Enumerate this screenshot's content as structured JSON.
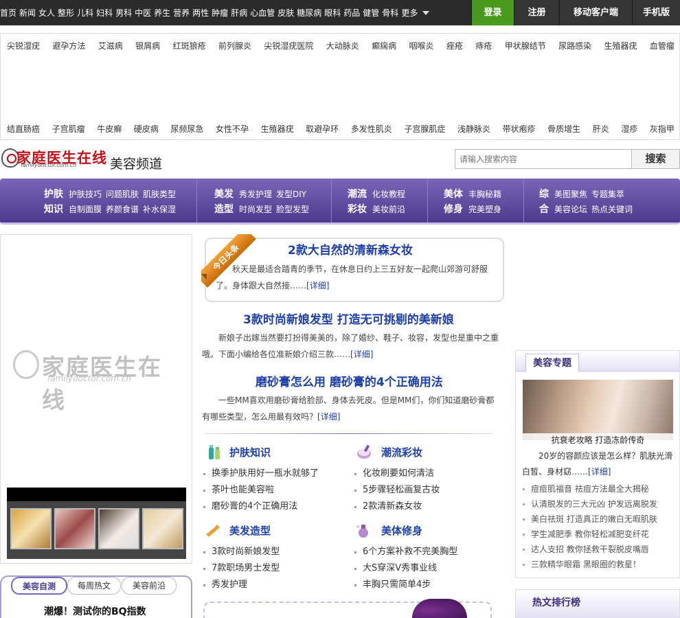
{
  "topnav": {
    "items": [
      "首页",
      "新闻",
      "女人",
      "整形",
      "儿科",
      "妇科",
      "男科",
      "中医",
      "养生",
      "营养",
      "两性",
      "肿瘤",
      "肝病",
      "心血管",
      "皮肤",
      "糖尿病",
      "眼科",
      "药品",
      "健管",
      "骨科"
    ],
    "more": "更多",
    "login": "登录",
    "register": "注册",
    "mobile_client": "移动客户端",
    "mobile_site": "手机版"
  },
  "diseases": {
    "row1": [
      "尖锐湿疣",
      "避孕方法",
      "艾滋病",
      "银屑病",
      "红斑狼疮",
      "前列腺炎",
      "尖锐湿疣医院",
      "大动脉炎",
      "癫痫病",
      "咽喉炎",
      "痤疮",
      "痔疮",
      "甲状腺结节",
      "尿路感染",
      "生殖器疣",
      "血管瘤"
    ],
    "row2": [
      "结直肠癌",
      "子宫肌瘤",
      "牛皮癣",
      "硬皮病",
      "尿频尿急",
      "女性不孕",
      "生殖器疣",
      "取避孕环",
      "多发性肌炎",
      "子宫腺肌症",
      "浅静脉炎",
      "带状疱疹",
      "骨质增生",
      "肝炎",
      "湿疹",
      "灰指甲"
    ]
  },
  "header": {
    "logo_text": "家庭医生在线",
    "logo_sub": "familydoctor.com.cn",
    "channel": "美容频道",
    "search_placeholder": "请输入搜索内容",
    "search_button": "搜索"
  },
  "catnav": [
    {
      "r1h": "护肤",
      "r1": [
        "护肤技巧",
        "问题肌肤",
        "肌肤类型"
      ],
      "r2h": "知识",
      "r2": [
        "自制面膜",
        "养颜食谱",
        "补水保湿"
      ]
    },
    {
      "r1h": "美发",
      "r1": [
        "秀发护理",
        "发型DIY"
      ],
      "r2h": "造型",
      "r2": [
        "时尚发型",
        "脸型发型"
      ]
    },
    {
      "r1h": "潮流",
      "r1": [
        "化妆教程"
      ],
      "r2h": "彩妆",
      "r2": [
        "美妆前沿"
      ]
    },
    {
      "r1h": "美体",
      "r1": [
        "丰胸秘籍"
      ],
      "r2h": "修身",
      "r2": [
        "完美塑身"
      ]
    },
    {
      "r1h": "综",
      "r1": [
        "美图聚焦",
        "专题集萃"
      ],
      "r2h": "合",
      "r2": [
        "美容论坛",
        "热点关键词"
      ]
    }
  ],
  "left": {
    "logo_text": "家庭医生在线",
    "logo_sub": "familydoctor.com.cn",
    "tabs": [
      "美容自测",
      "每周热文",
      "美容前沿"
    ],
    "quiz_title": "潮爆！测试你的BQ指数"
  },
  "headline": {
    "badge": "今日头条",
    "title": "2款大自然的清新森女妆",
    "body": "秋天是最适合踏青的季节，在休息日约上三五好友一起爬山郊游可舒服了。身体跟大自然接……",
    "more": "[详细]"
  },
  "articles": [
    {
      "title": "3款时尚新娘发型 打造无可挑剔的美新娘",
      "body": "新娘子出嫁当然要打扮得美美的，除了婚纱、鞋子、妆容，发型也是重中之重哦。下面小编给各位准新娘介绍三款……",
      "more": "[详细]"
    },
    {
      "title": "磨砂膏怎么用 磨砂膏的4个正确用法",
      "body": "一些MM喜欢用磨砂膏给脸部、身体去死皮。但是MM们，你们知道磨砂膏都有哪些类型，怎么用最有效吗？",
      "more": "[详细]"
    }
  ],
  "sections": [
    {
      "title": "护肤知识",
      "items": [
        "换季护肤用好一瓶水就够了",
        "茶叶也能美容啦",
        "磨砂膏的4个正确用法"
      ]
    },
    {
      "title": "潮流彩妆",
      "items": [
        "化妆刷要如何清洁",
        "5步骤轻松画复古妆",
        "2款清新森女妆"
      ]
    },
    {
      "title": "美发造型",
      "items": [
        "3款时尚新娘发型",
        "7款职场男士发型",
        "秀发护理"
      ]
    },
    {
      "title": "美体修身",
      "items": [
        "6个方案补救不完美胸型",
        "大S穿深V秀事业线",
        "丰胸只需简单4步"
      ]
    }
  ],
  "topics": {
    "title": "美容专题",
    "caption": "抗衰老攻略 打造冻龄传奇",
    "desc": "20岁的容颜应该是怎么样？肌肤光滑白皙、身材窈……",
    "more": "[详细]",
    "items": [
      "痘痘肌福音 祛痘方法最全大揭秘",
      "认清脱发的三大元凶 护发远离脱发",
      "美白祛斑 打造真正的嫩白无暇肌肤",
      "学生减肥季 教你轻松减肥变纤花",
      "达人支招 教你拯救干裂脱皮嘴唇",
      "三款精华眼霜 黑眼圈的救星！"
    ]
  },
  "hot": {
    "title": "热文排行榜"
  },
  "colors": {
    "accent": "#5a46a0",
    "link": "#1e3fa8",
    "login": "#4a9a1e",
    "badge": "#e08a1c"
  }
}
